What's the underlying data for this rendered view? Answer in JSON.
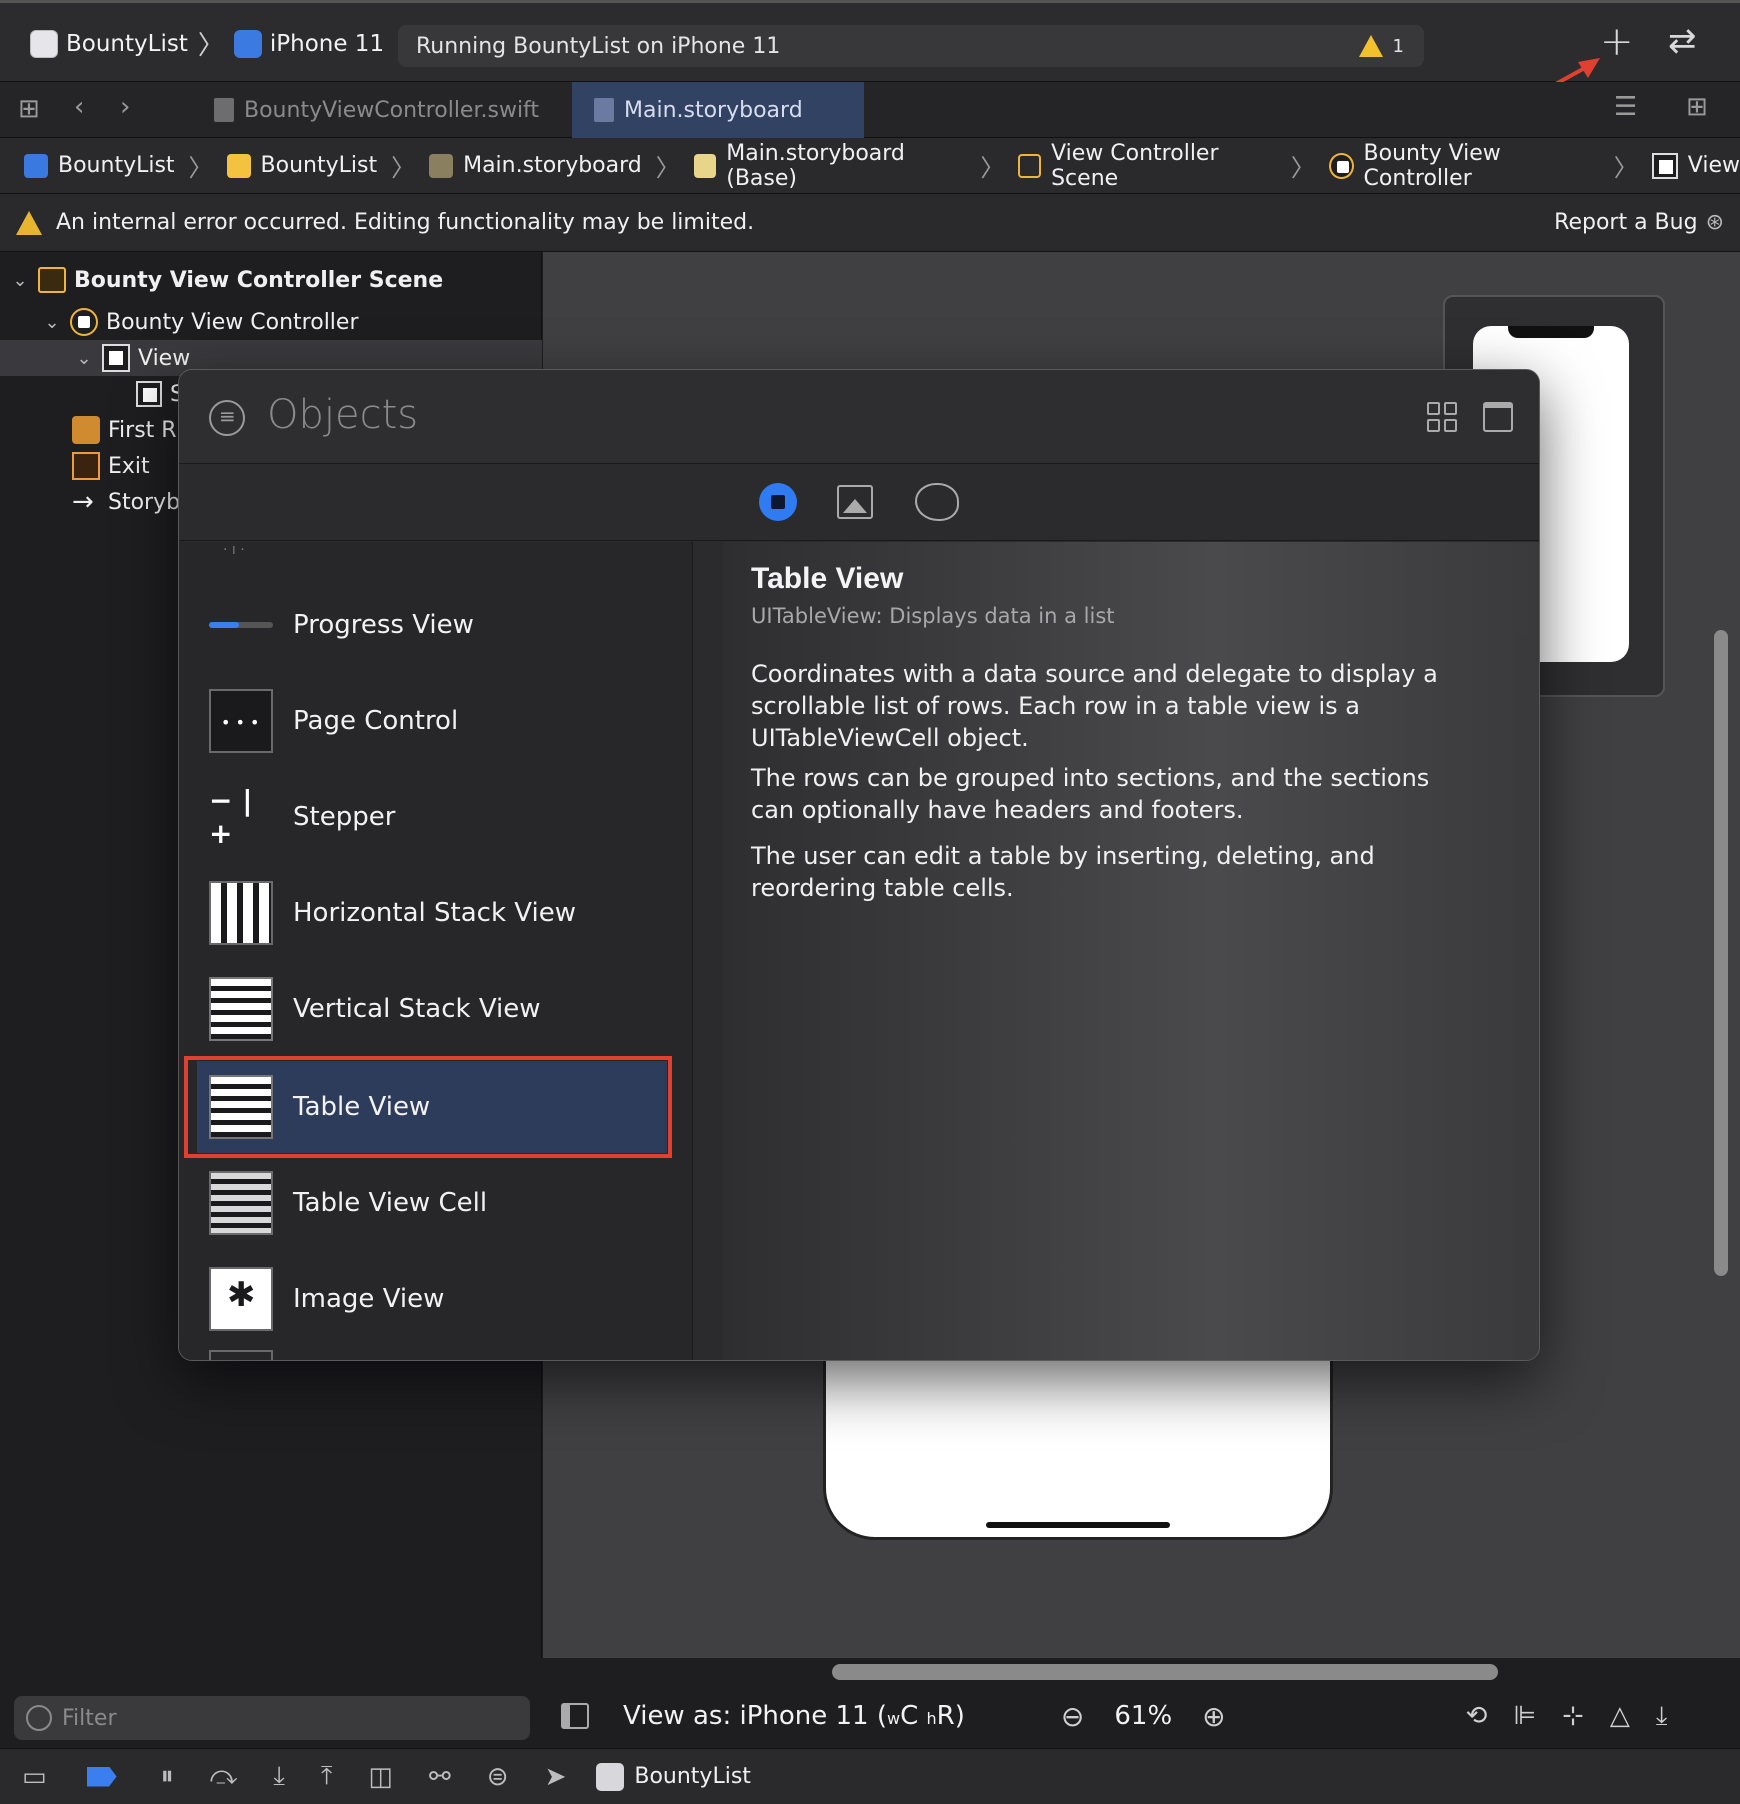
{
  "toolbar": {
    "scheme_name": "BountyList",
    "device_name": "iPhone 11",
    "activity_text": "Running BountyList on iPhone 11",
    "warning_count": "1",
    "add_icon": "plus-icon",
    "swap_icon": "swap-arrows-icon"
  },
  "tabs": [
    {
      "label": "BountyViewController.swift"
    },
    {
      "label": "Main.storyboard"
    }
  ],
  "jumpbar": [
    {
      "label": "BountyList"
    },
    {
      "label": "BountyList"
    },
    {
      "label": "Main.storyboard"
    },
    {
      "label": "Main.storyboard (Base)"
    },
    {
      "label": "View Controller Scene"
    },
    {
      "label": "Bounty View Controller"
    },
    {
      "label": "View"
    }
  ],
  "error": {
    "message": "An internal error occurred. Editing functionality may be limited.",
    "action": "Report a Bug"
  },
  "outline": {
    "scene": "Bounty View Controller Scene",
    "controller": "Bounty View Controller",
    "view": "View",
    "child_partial": "S",
    "first_responder": "First R",
    "exit": "Exit",
    "storyboard": "Storyb"
  },
  "objects_library": {
    "search_placeholder": "Objects",
    "items": [
      {
        "label": "Progress View",
        "icon": "progress-view-icon"
      },
      {
        "label": "Page Control",
        "icon": "page-control-icon"
      },
      {
        "label": "Stepper",
        "icon": "stepper-icon"
      },
      {
        "label": "Horizontal Stack View",
        "icon": "horizontal-stack-icon"
      },
      {
        "label": "Vertical Stack View",
        "icon": "vertical-stack-icon"
      },
      {
        "label": "Table View",
        "icon": "table-view-icon",
        "selected": true
      },
      {
        "label": "Table View Cell",
        "icon": "table-view-cell-icon"
      },
      {
        "label": "Image View",
        "icon": "image-view-icon"
      }
    ],
    "detail": {
      "title": "Table View",
      "subtitle": "UITableView: Displays data in a list",
      "paragraphs": [
        "Coordinates with a data source and delegate to display a scrollable list of rows. Each row in a table view is a UITableViewCell object.",
        "The rows can be grouped into sections, and the sections can optionally have headers and footers.",
        "The user can edit a table by inserting, deleting, and reordering table cells."
      ]
    }
  },
  "canvas_bar": {
    "view_as": "View as: iPhone 11 (",
    "size_w": "w",
    "size_c": "C",
    "size_h": "h",
    "size_r": "R",
    "close_paren": ")",
    "zoom": "61%"
  },
  "filter": {
    "placeholder": "Filter"
  },
  "debug": {
    "target": "BountyList"
  },
  "colors": {
    "accent": "#2f7bf2",
    "selection": "#2e3c5c",
    "highlight_outline": "#e0402f",
    "warning": "#f2c12e"
  }
}
